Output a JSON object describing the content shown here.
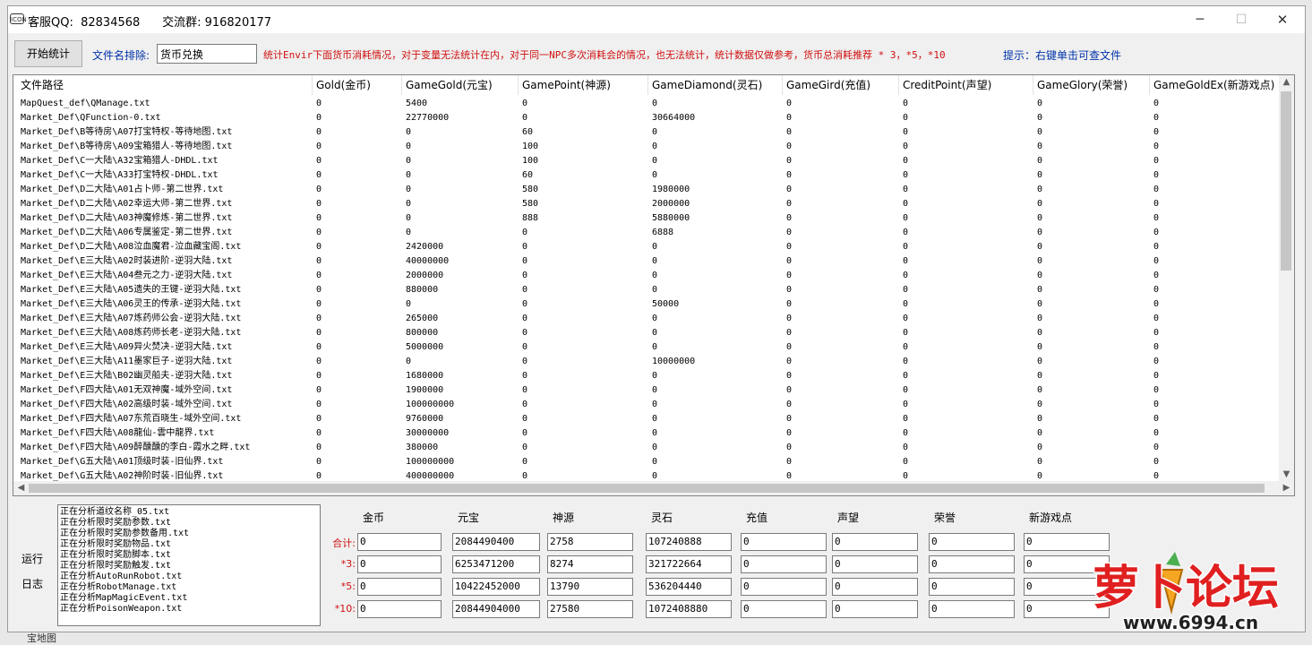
{
  "window": {
    "title": "客服QQ:  82834568      交流群: 916820177",
    "icon_name": "app-logo-icon",
    "icon_text": "ICON"
  },
  "toolbar": {
    "start_label": "开始统计",
    "exclude_label": "文件名排除:",
    "exclude_value": "货币兑换",
    "notice": "统计Envir下面货币消耗情况，对于变量无法统计在内，对于同一NPC多次消耗会的情况，也无法统计，统计数据仅做参考，货币总消耗推荐 * 3，*5，*10",
    "hint": "提示：右键单击可查文件"
  },
  "grid": {
    "columns": [
      "文件路径",
      "Gold(金币)",
      "GameGold(元宝)",
      "GamePoint(神源)",
      "GameDiamond(灵石)",
      "GameGird(充值)",
      "CreditPoint(声望)",
      "GameGlory(荣誉)",
      "GameGoldEx(新游戏点)"
    ],
    "rows": [
      [
        "MapQuest_def\\QManage.txt",
        "0",
        "5400",
        "0",
        "0",
        "0",
        "0",
        "0",
        "0"
      ],
      [
        "Market_Def\\QFunction-0.txt",
        "0",
        "22770000",
        "0",
        "30664000",
        "0",
        "0",
        "0",
        "0"
      ],
      [
        "Market_Def\\B等待房\\A07打宝特权-等待地图.txt",
        "0",
        "0",
        "60",
        "0",
        "0",
        "0",
        "0",
        "0"
      ],
      [
        "Market_Def\\B等待房\\A09宝箱猎人-等待地图.txt",
        "0",
        "0",
        "100",
        "0",
        "0",
        "0",
        "0",
        "0"
      ],
      [
        "Market_Def\\C一大陆\\A32宝箱猎人-DHDL.txt",
        "0",
        "0",
        "100",
        "0",
        "0",
        "0",
        "0",
        "0"
      ],
      [
        "Market_Def\\C一大陆\\A33打宝特权-DHDL.txt",
        "0",
        "0",
        "60",
        "0",
        "0",
        "0",
        "0",
        "0"
      ],
      [
        "Market_Def\\D二大陆\\A01占卜师-第二世界.txt",
        "0",
        "0",
        "580",
        "1980000",
        "0",
        "0",
        "0",
        "0"
      ],
      [
        "Market_Def\\D二大陆\\A02幸运大师-第二世界.txt",
        "0",
        "0",
        "580",
        "2000000",
        "0",
        "0",
        "0",
        "0"
      ],
      [
        "Market_Def\\D二大陆\\A03神魔修炼-第二世界.txt",
        "0",
        "0",
        "888",
        "5880000",
        "0",
        "0",
        "0",
        "0"
      ],
      [
        "Market_Def\\D二大陆\\A06专属鉴定-第二世界.txt",
        "0",
        "0",
        "0",
        "6888",
        "0",
        "0",
        "0",
        "0"
      ],
      [
        "Market_Def\\D二大陆\\A08泣血魔君-泣血藏宝阁.txt",
        "0",
        "2420000",
        "0",
        "0",
        "0",
        "0",
        "0",
        "0"
      ],
      [
        "Market_Def\\E三大陆\\A02时装进阶-逆羽大陆.txt",
        "0",
        "40000000",
        "0",
        "0",
        "0",
        "0",
        "0",
        "0"
      ],
      [
        "Market_Def\\E三大陆\\A04叁元之力-逆羽大陆.txt",
        "0",
        "2000000",
        "0",
        "0",
        "0",
        "0",
        "0",
        "0"
      ],
      [
        "Market_Def\\E三大陆\\A05遗失的王键-逆羽大陆.txt",
        "0",
        "880000",
        "0",
        "0",
        "0",
        "0",
        "0",
        "0"
      ],
      [
        "Market_Def\\E三大陆\\A06灵王的传承-逆羽大陆.txt",
        "0",
        "0",
        "0",
        "50000",
        "0",
        "0",
        "0",
        "0"
      ],
      [
        "Market_Def\\E三大陆\\A07炼药师公会-逆羽大陆.txt",
        "0",
        "265000",
        "0",
        "0",
        "0",
        "0",
        "0",
        "0"
      ],
      [
        "Market_Def\\E三大陆\\A08炼药师长老-逆羽大陆.txt",
        "0",
        "800000",
        "0",
        "0",
        "0",
        "0",
        "0",
        "0"
      ],
      [
        "Market_Def\\E三大陆\\A09异火焚决-逆羽大陆.txt",
        "0",
        "5000000",
        "0",
        "0",
        "0",
        "0",
        "0",
        "0"
      ],
      [
        "Market_Def\\E三大陆\\A11墨家巨子-逆羽大陆.txt",
        "0",
        "0",
        "0",
        "10000000",
        "0",
        "0",
        "0",
        "0"
      ],
      [
        "Market_Def\\E三大陆\\B02幽灵船夫-逆羽大陆.txt",
        "0",
        "1680000",
        "0",
        "0",
        "0",
        "0",
        "0",
        "0"
      ],
      [
        "Market_Def\\F四大陆\\A01无双神魔-域外空间.txt",
        "0",
        "1900000",
        "0",
        "0",
        "0",
        "0",
        "0",
        "0"
      ],
      [
        "Market_Def\\F四大陆\\A02高级时装-域外空间.txt",
        "0",
        "100000000",
        "0",
        "0",
        "0",
        "0",
        "0",
        "0"
      ],
      [
        "Market_Def\\F四大陆\\A07东荒百晓生-域外空间.txt",
        "0",
        "9760000",
        "0",
        "0",
        "0",
        "0",
        "0",
        "0"
      ],
      [
        "Market_Def\\F四大陆\\A08龍仙-雲中龍界.txt",
        "0",
        "30000000",
        "0",
        "0",
        "0",
        "0",
        "0",
        "0"
      ],
      [
        "Market_Def\\F四大陆\\A09醉醺醺的李白-霞水之畔.txt",
        "0",
        "380000",
        "0",
        "0",
        "0",
        "0",
        "0",
        "0"
      ],
      [
        "Market_Def\\G五大陆\\A01顶级时装-旧仙界.txt",
        "0",
        "100000000",
        "0",
        "0",
        "0",
        "0",
        "0",
        "0"
      ],
      [
        "Market_Def\\G五大陆\\A02神阶时装-旧仙界.txt",
        "0",
        "400000000",
        "0",
        "0",
        "0",
        "0",
        "0",
        "0"
      ]
    ]
  },
  "log": {
    "label_top": "运行",
    "label_bottom": "日志",
    "lines": [
      "正在分析道纹名称_05.txt",
      "正在分析限时奖励参数.txt",
      "正在分析限时奖励参数备用.txt",
      "正在分析限时奖励物品.txt",
      "正在分析限时奖励脚本.txt",
      "正在分析限时奖励触发.txt",
      "正在分析AutoRunRobot.txt",
      "正在分析RobotManage.txt",
      "正在分析MapMagicEvent.txt",
      "正在分析PoisonWeapon.txt"
    ]
  },
  "summary": {
    "columns": [
      "金币",
      "元宝",
      "神源",
      "灵石",
      "充值",
      "声望",
      "荣誉",
      "新游戏点"
    ],
    "rows": [
      {
        "label": "合计:",
        "values": [
          "0",
          "2084490400",
          "2758",
          "107240888",
          "0",
          "0",
          "0",
          "0"
        ]
      },
      {
        "label": "*3:",
        "values": [
          "0",
          "6253471200",
          "8274",
          "321722664",
          "0",
          "0",
          "0",
          "0"
        ]
      },
      {
        "label": "*5:",
        "values": [
          "0",
          "10422452000",
          "13790",
          "536204440",
          "0",
          "0",
          "0",
          "0"
        ]
      },
      {
        "label": "*10:",
        "values": [
          "0",
          "20844904000",
          "27580",
          "1072408880",
          "0",
          "0",
          "0",
          "0"
        ]
      }
    ]
  },
  "watermark": {
    "text": "萝卜论坛",
    "site": "www.6994.cn"
  },
  "colors": {
    "notice": "#d01010",
    "label_blue": "#0033aa",
    "watermark_red": "#e02020",
    "watermark_orange": "#f5a623"
  },
  "background": {
    "bottom_text": "宝地图"
  }
}
